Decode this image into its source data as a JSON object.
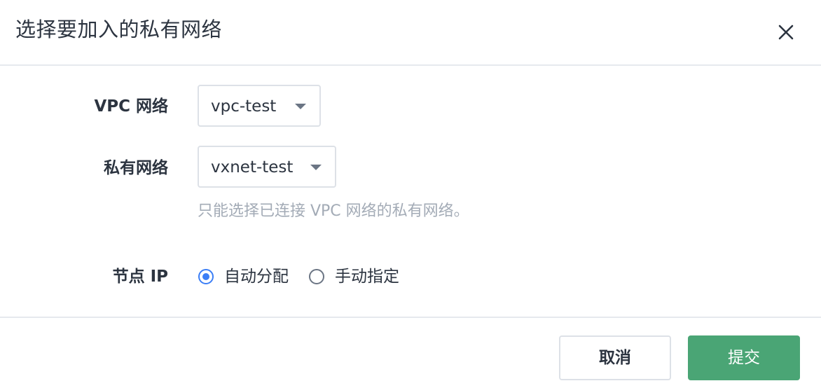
{
  "dialog": {
    "title": "选择要加入的私有网络"
  },
  "form": {
    "vpc": {
      "label": "VPC 网络",
      "value": "vpc-test"
    },
    "vxnet": {
      "label": "私有网络",
      "value": "vxnet-test",
      "hint": "只能选择已连接 VPC 网络的私有网络。"
    },
    "node_ip": {
      "label": "节点 IP",
      "options": [
        {
          "label": "自动分配",
          "checked": true
        },
        {
          "label": "手动指定",
          "checked": false
        }
      ]
    }
  },
  "footer": {
    "cancel_label": "取消",
    "submit_label": "提交"
  },
  "colors": {
    "primary": "#4aa575",
    "radio_accent": "#3b7ef6"
  },
  "icons": {
    "close": "close-icon",
    "caret": "caret-down-icon"
  }
}
